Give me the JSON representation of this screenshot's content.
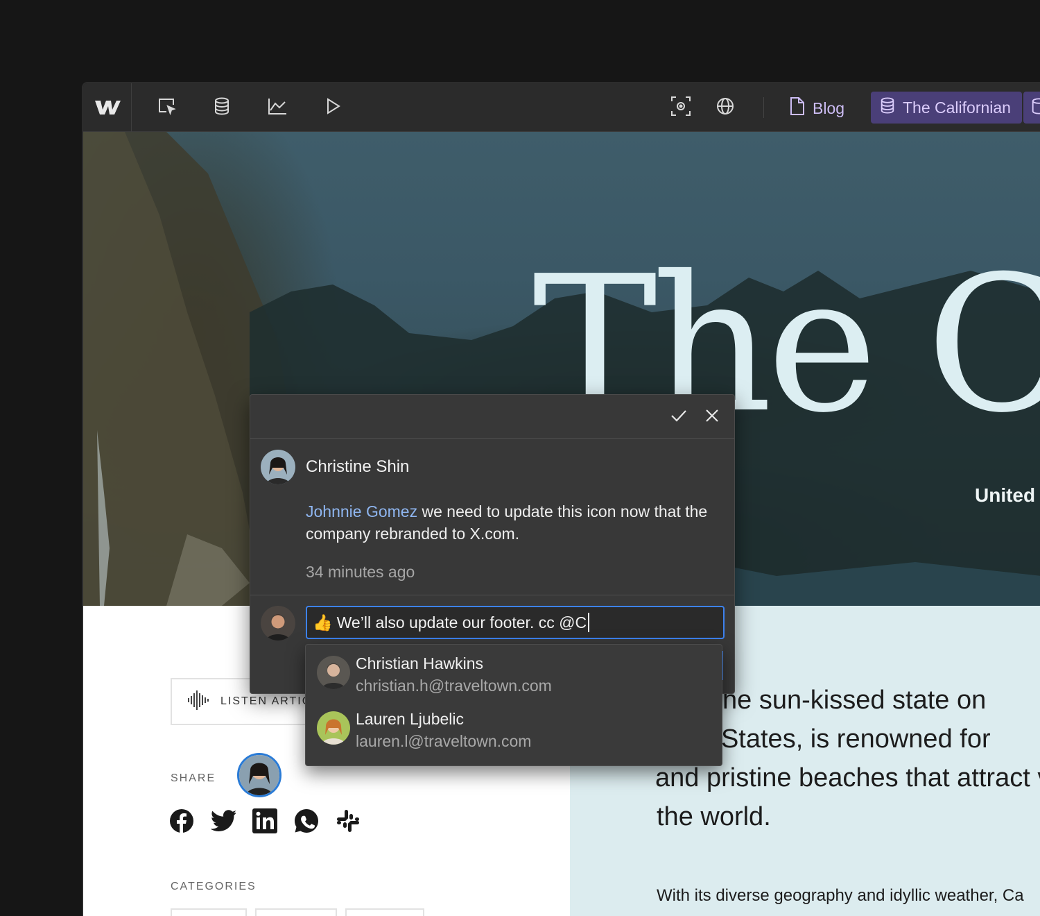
{
  "toolbar": {
    "page_label": "Blog",
    "collection_label": "The Californian",
    "icons": [
      "webflow-logo",
      "cursor-select-icon",
      "database-icon",
      "analytics-chart-icon",
      "play-icon",
      "screenshot-icon",
      "globe-icon",
      "page-icon",
      "collection-icon"
    ]
  },
  "hero": {
    "title": "The Ca",
    "subtitle": "United S"
  },
  "article": {
    "listen_label": "LISTEN ARTIC",
    "share_label": "SHARE",
    "categories_label": "CATEGORIES",
    "body_lines": [
      "rnia, the sun-kissed state on",
      "nited States, is renowned for",
      "and pristine beaches that attract v",
      "the world."
    ],
    "body_small": "With its diverse geography and idyllic weather, Ca",
    "socials": [
      "facebook-icon",
      "twitter-icon",
      "linkedin-icon",
      "whatsapp-icon",
      "slack-icon"
    ]
  },
  "comment": {
    "author": "Christine Shin",
    "mention": "Johnnie Gomez",
    "text": " we need to update this icon now that the company rebranded to X.com.",
    "time": "34 minutes ago",
    "reply_emoji": "👍",
    "reply_value": "We’ll also update our footer. cc @C"
  },
  "mentions": [
    {
      "name": "Christian Hawkins",
      "email": "christian.h@traveltown.com"
    },
    {
      "name": "Lauren Ljubelic",
      "email": "lauren.l@traveltown.com"
    }
  ],
  "colors": {
    "accent": "#3d82ee",
    "collection_bg": "#4a3f78",
    "mention_text": "#8fb6f0",
    "hero_title": "#dceef2"
  }
}
